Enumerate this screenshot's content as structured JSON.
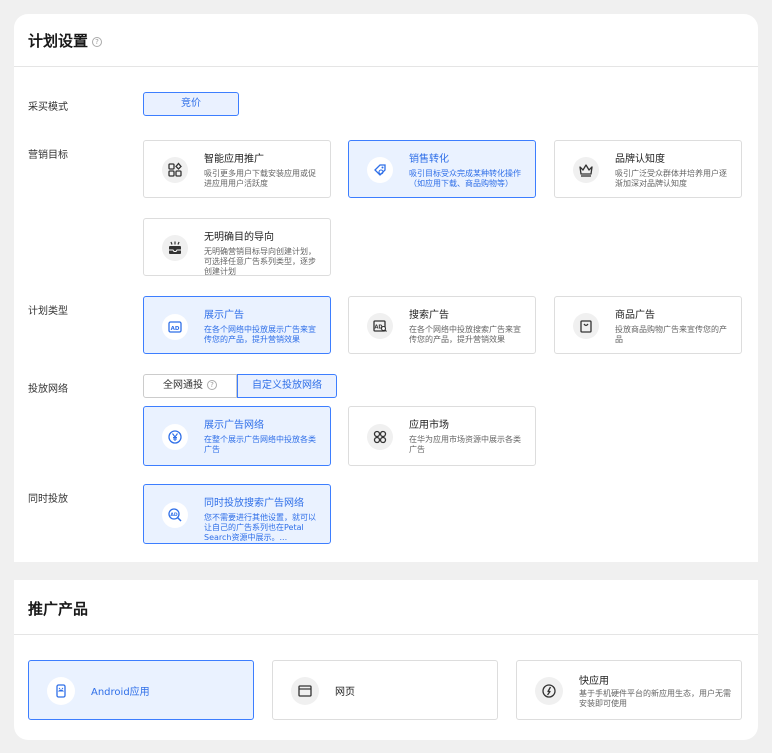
{
  "plan_settings": {
    "title": "计划设置",
    "help_icon": "question-circle-icon",
    "purchase_mode": {
      "label": "采买模式",
      "options": [
        {
          "label": "竞价",
          "selected": true
        }
      ]
    },
    "marketing_goal": {
      "label": "营销目标",
      "options": [
        {
          "title": "智能应用推广",
          "desc": "吸引更多用户下载安装应用或促进应用用户活跃度",
          "icon": "apps-icon",
          "selected": false
        },
        {
          "title": "销售转化",
          "desc": "吸引目标受众完成某种转化操作（如应用下载、商品购物等）",
          "icon": "conversion-icon",
          "selected": true
        },
        {
          "title": "品牌认知度",
          "desc": "吸引广泛受众群体并培养用户逐渐加深对品牌认知度",
          "icon": "crown-icon",
          "selected": false
        },
        {
          "title": "无明确目的导向",
          "desc": "无明确营销目标导向创建计划，可选择任意广告系列类型，逐步创建计划",
          "icon": "inbox-icon",
          "selected": false
        }
      ]
    },
    "plan_type": {
      "label": "计划类型",
      "options": [
        {
          "title": "展示广告",
          "desc": "在各个网络中投放展示广告来宣传您的产品，提升营销效果",
          "icon": "ad-display-icon",
          "selected": true
        },
        {
          "title": "搜索广告",
          "desc": "在各个网络中投放搜索广告来宣传您的产品，提升营销效果",
          "icon": "ad-search-icon",
          "selected": false
        },
        {
          "title": "商品广告",
          "desc": "投放商品购物广告来宣传您的产品",
          "icon": "shopping-bag-icon",
          "selected": false
        }
      ]
    },
    "network": {
      "label": "投放网络",
      "tabs": [
        {
          "label": "全网通投",
          "selected": false
        },
        {
          "label": "自定义投放网络",
          "selected": true
        }
      ],
      "options": [
        {
          "title": "展示广告网络",
          "desc": "在整个展示广告网络中投放各类广告",
          "icon": "yen-circle-icon",
          "selected": true
        },
        {
          "title": "应用市场",
          "desc": "在华为应用市场资源中展示各类广告",
          "icon": "app-market-icon",
          "selected": false
        }
      ]
    },
    "simultaneous": {
      "label": "同时投放",
      "option": {
        "title": "同时投放搜索广告网络",
        "desc": "您不需要进行其他设置，就可以让自己的广告系列也在Petal Search资源中展示。...",
        "icon": "search-ad-icon",
        "selected": true
      }
    }
  },
  "promoted_product": {
    "title": "推广产品",
    "options": [
      {
        "title": "Android应用",
        "desc": "",
        "icon": "android-phone-icon",
        "selected": true
      },
      {
        "title": "网页",
        "desc": "",
        "icon": "webpage-icon",
        "selected": false
      },
      {
        "title": "快应用",
        "desc": "基于手机硬件平台的新应用生态，用户无需安装即可使用",
        "icon": "quick-app-icon",
        "selected": false
      }
    ]
  },
  "colors": {
    "accent": "#3d7eff",
    "accent_bg": "#eaf2ff",
    "text": "#222222"
  }
}
